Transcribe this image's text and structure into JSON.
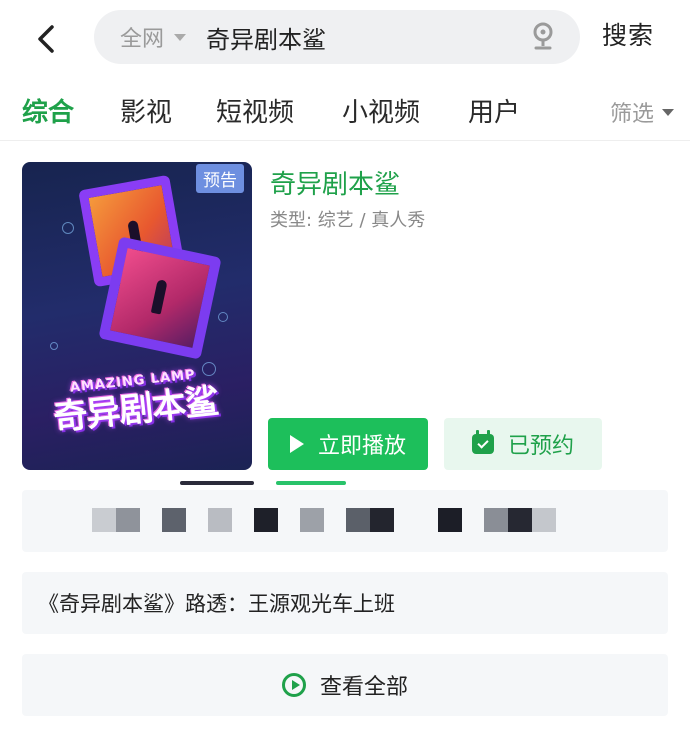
{
  "header": {
    "search_scope": "全网",
    "search_query": "奇异剧本鲨",
    "search_button": "搜索"
  },
  "tabs": [
    {
      "label": "综合",
      "active": true
    },
    {
      "label": "影视",
      "active": false
    },
    {
      "label": "短视频",
      "active": false
    },
    {
      "label": "小视频",
      "active": false
    },
    {
      "label": "用户",
      "active": false
    }
  ],
  "filter_label": "筛选",
  "result": {
    "badge": "预告",
    "poster_logo_en": "AMAZING LAMP",
    "poster_logo_cn": "奇异剧本鲨",
    "title": "奇异剧本鲨",
    "meta": "类型: 综艺 / 真人秀",
    "play_label": "立即播放",
    "reserve_label": "已预约"
  },
  "clip": {
    "text": "《奇异剧本鲨》路透：王源观光车上班"
  },
  "view_all_label": "查看全部",
  "colors": {
    "accent": "#1fa14a",
    "play_button": "#1dbf5b",
    "reserve_bg": "#e8f7ee",
    "row_bg": "#f5f7f9"
  },
  "icons": [
    "back-arrow-icon",
    "caret-down-icon",
    "microphone-icon",
    "play-icon",
    "calendar-check-icon",
    "play-circle-icon"
  ]
}
